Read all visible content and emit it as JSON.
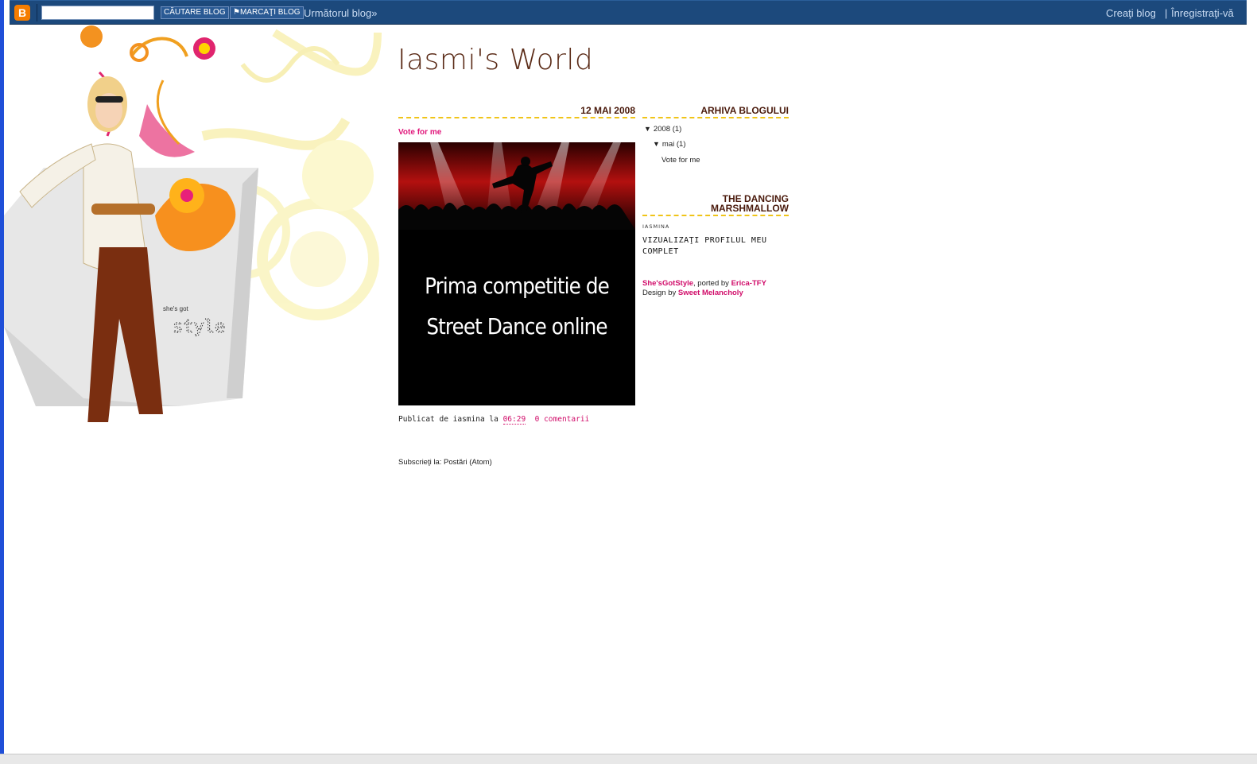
{
  "navbar": {
    "search_placeholder": "",
    "search_button": "CĂUTARE BLOG",
    "mark_button": "MARCAŢI BLOG",
    "mark_flag": "⚑",
    "next_blog": "Următorul blog»",
    "create_blog": "Creaţi blog",
    "separator": "|",
    "signin": "Înregistraţi-vă"
  },
  "header_art": {
    "tagline_small": "she's got",
    "tagline_big": "style"
  },
  "blog": {
    "title": "Iasmi's World"
  },
  "post": {
    "date": "12 MAI 2008",
    "title": "Vote for me",
    "image_line1": "Prima competitie de",
    "image_line2": "Street Dance online",
    "footer_prefix": "Publicat de iasmina la",
    "time": "06:29",
    "comments": "0 comentarii"
  },
  "subscribe": {
    "label": "Subscrieţi la: Postări (Atom)"
  },
  "sidebar": {
    "archive_title": "ARHIVA BLOGULUI",
    "archive_year": "2008 (1)",
    "archive_month": "mai (1)",
    "archive_post": "Vote for me",
    "toggle_symbol": "▼",
    "profile_title": "THE DANCING MARSHMALLOW",
    "profile_name": "IASMINA",
    "profile_link": "VIZUALIZAŢI PROFILUL MEU COMPLET",
    "credit_template": "She'sGotStyle",
    "credit_ported": ", ported by ",
    "credit_porter": "Erica-TFY",
    "credit_design": "Design by ",
    "credit_designer": "Sweet Melancholy"
  },
  "colors": {
    "navbar": "#1c497c",
    "accent_pink": "#d10d6a",
    "dashed_underline": "#f0c419",
    "title_brown": "#5a2a16"
  }
}
